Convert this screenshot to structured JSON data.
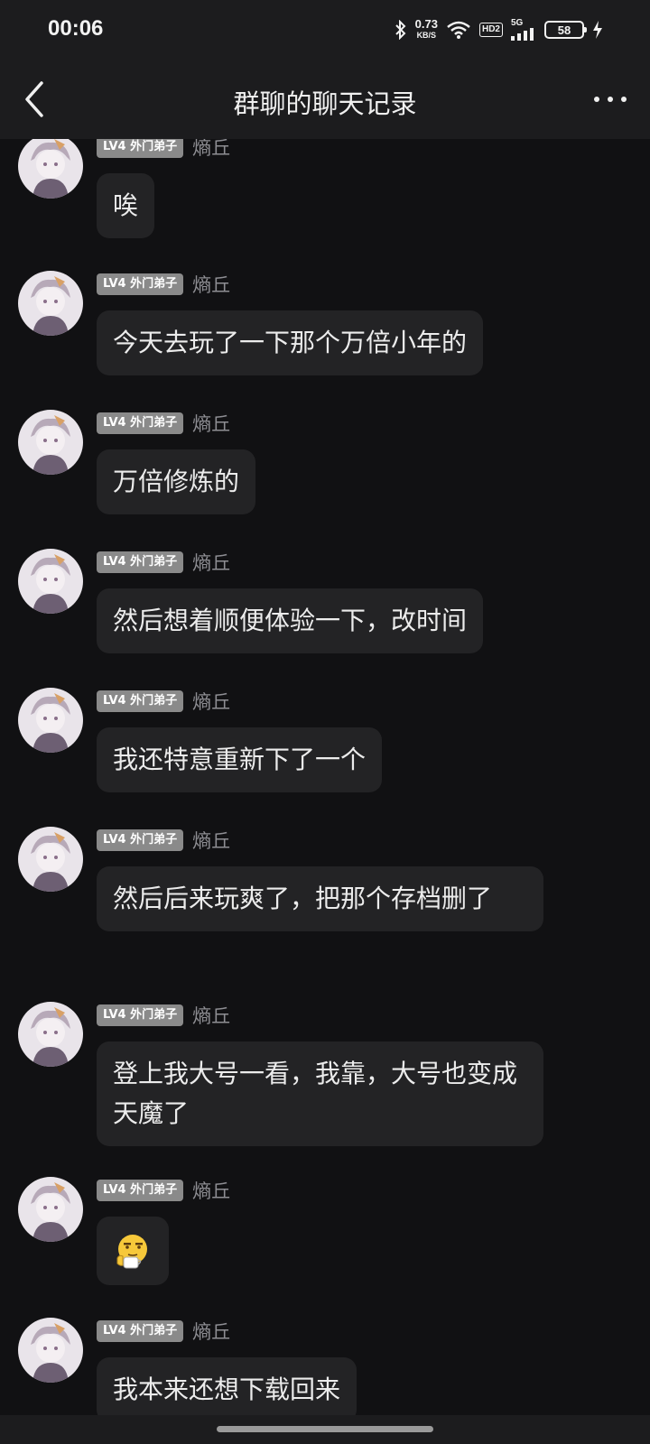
{
  "status_bar": {
    "time": "00:06",
    "net_speed_value": "0.73",
    "net_speed_unit": "KB/S",
    "hd_label": "HD2",
    "signal_label": "5G",
    "battery": "58"
  },
  "header": {
    "title": "群聊的聊天记录"
  },
  "messages": [
    {
      "level": "LV4 外门弟子",
      "name": "熵丘",
      "text": "唉"
    },
    {
      "level": "LV4 外门弟子",
      "name": "熵丘",
      "text": "今天去玩了一下那个万倍小年的"
    },
    {
      "level": "LV4 外门弟子",
      "name": "熵丘",
      "text": "万倍修炼的"
    },
    {
      "level": "LV4 外门弟子",
      "name": "熵丘",
      "text": "然后想着顺便体验一下，改时间"
    },
    {
      "level": "LV4 外门弟子",
      "name": "熵丘",
      "text": "我还特意重新下了一个"
    },
    {
      "level": "LV4 外门弟子",
      "name": "熵丘",
      "text": "然后后来玩爽了，把那个存档删了"
    },
    {
      "level": "LV4 外门弟子",
      "name": "熵丘",
      "text": "登上我大号一看，我靠，大号也变成天魔了"
    },
    {
      "level": "LV4 外门弟子",
      "name": "熵丘",
      "text": "",
      "emoji": "tea-drinking-emoji"
    },
    {
      "level": "LV4 外门弟子",
      "name": "熵丘",
      "text": "我本来还想下载回来"
    }
  ]
}
